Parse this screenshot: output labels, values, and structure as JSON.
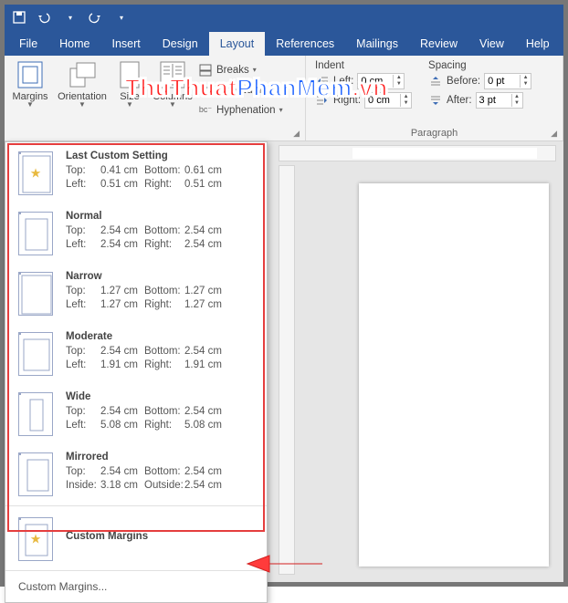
{
  "qat": {
    "save": "save-icon",
    "undo": "undo-icon",
    "redo": "redo-icon"
  },
  "tabs": [
    "File",
    "Home",
    "Insert",
    "Design",
    "Layout",
    "References",
    "Mailings",
    "Review",
    "View",
    "Help"
  ],
  "active_tab": "Layout",
  "ribbon": {
    "page_setup": {
      "margins": "Margins",
      "orientation": "Orientation",
      "size": "Size",
      "columns": "Columns",
      "breaks": "Breaks",
      "line_numbers": "Line Numbers",
      "hyphenation": "Hyphenation"
    },
    "indent": {
      "label": "Indent",
      "left_label": "Left:",
      "left_value": "0 cm",
      "right_label": "Right:",
      "right_value": "0 cm"
    },
    "spacing": {
      "label": "Spacing",
      "before_label": "Before:",
      "before_value": "0 pt",
      "after_label": "After:",
      "after_value": "3 pt"
    },
    "paragraph_label": "Paragraph"
  },
  "margins_menu": {
    "items": [
      {
        "title": "Last Custom Setting",
        "l1a": "Top:",
        "l1b": "0.41 cm",
        "l1c": "Bottom:",
        "l1d": "0.61 cm",
        "l2a": "Left:",
        "l2b": "0.51 cm",
        "l2c": "Right:",
        "l2d": "0.51 cm",
        "star": true
      },
      {
        "title": "Normal",
        "l1a": "Top:",
        "l1b": "2.54 cm",
        "l1c": "Bottom:",
        "l1d": "2.54 cm",
        "l2a": "Left:",
        "l2b": "2.54 cm",
        "l2c": "Right:",
        "l2d": "2.54 cm"
      },
      {
        "title": "Narrow",
        "l1a": "Top:",
        "l1b": "1.27 cm",
        "l1c": "Bottom:",
        "l1d": "1.27 cm",
        "l2a": "Left:",
        "l2b": "1.27 cm",
        "l2c": "Right:",
        "l2d": "1.27 cm"
      },
      {
        "title": "Moderate",
        "l1a": "Top:",
        "l1b": "2.54 cm",
        "l1c": "Bottom:",
        "l1d": "2.54 cm",
        "l2a": "Left:",
        "l2b": "1.91 cm",
        "l2c": "Right:",
        "l2d": "1.91 cm"
      },
      {
        "title": "Wide",
        "l1a": "Top:",
        "l1b": "2.54 cm",
        "l1c": "Bottom:",
        "l1d": "2.54 cm",
        "l2a": "Left:",
        "l2b": "5.08 cm",
        "l2c": "Right:",
        "l2d": "5.08 cm"
      },
      {
        "title": "Mirrored",
        "l1a": "Top:",
        "l1b": "2.54 cm",
        "l1c": "Bottom:",
        "l1d": "2.54 cm",
        "l2a": "Inside:",
        "l2b": "3.18 cm",
        "l2c": "Outside:",
        "l2d": "2.54 cm"
      }
    ],
    "custom_big": "Custom Margins",
    "custom_link": "Custom Margins..."
  },
  "watermark": {
    "part1": "ThuThuat",
    "part2": "PhanMem",
    "part3": ".vn"
  }
}
